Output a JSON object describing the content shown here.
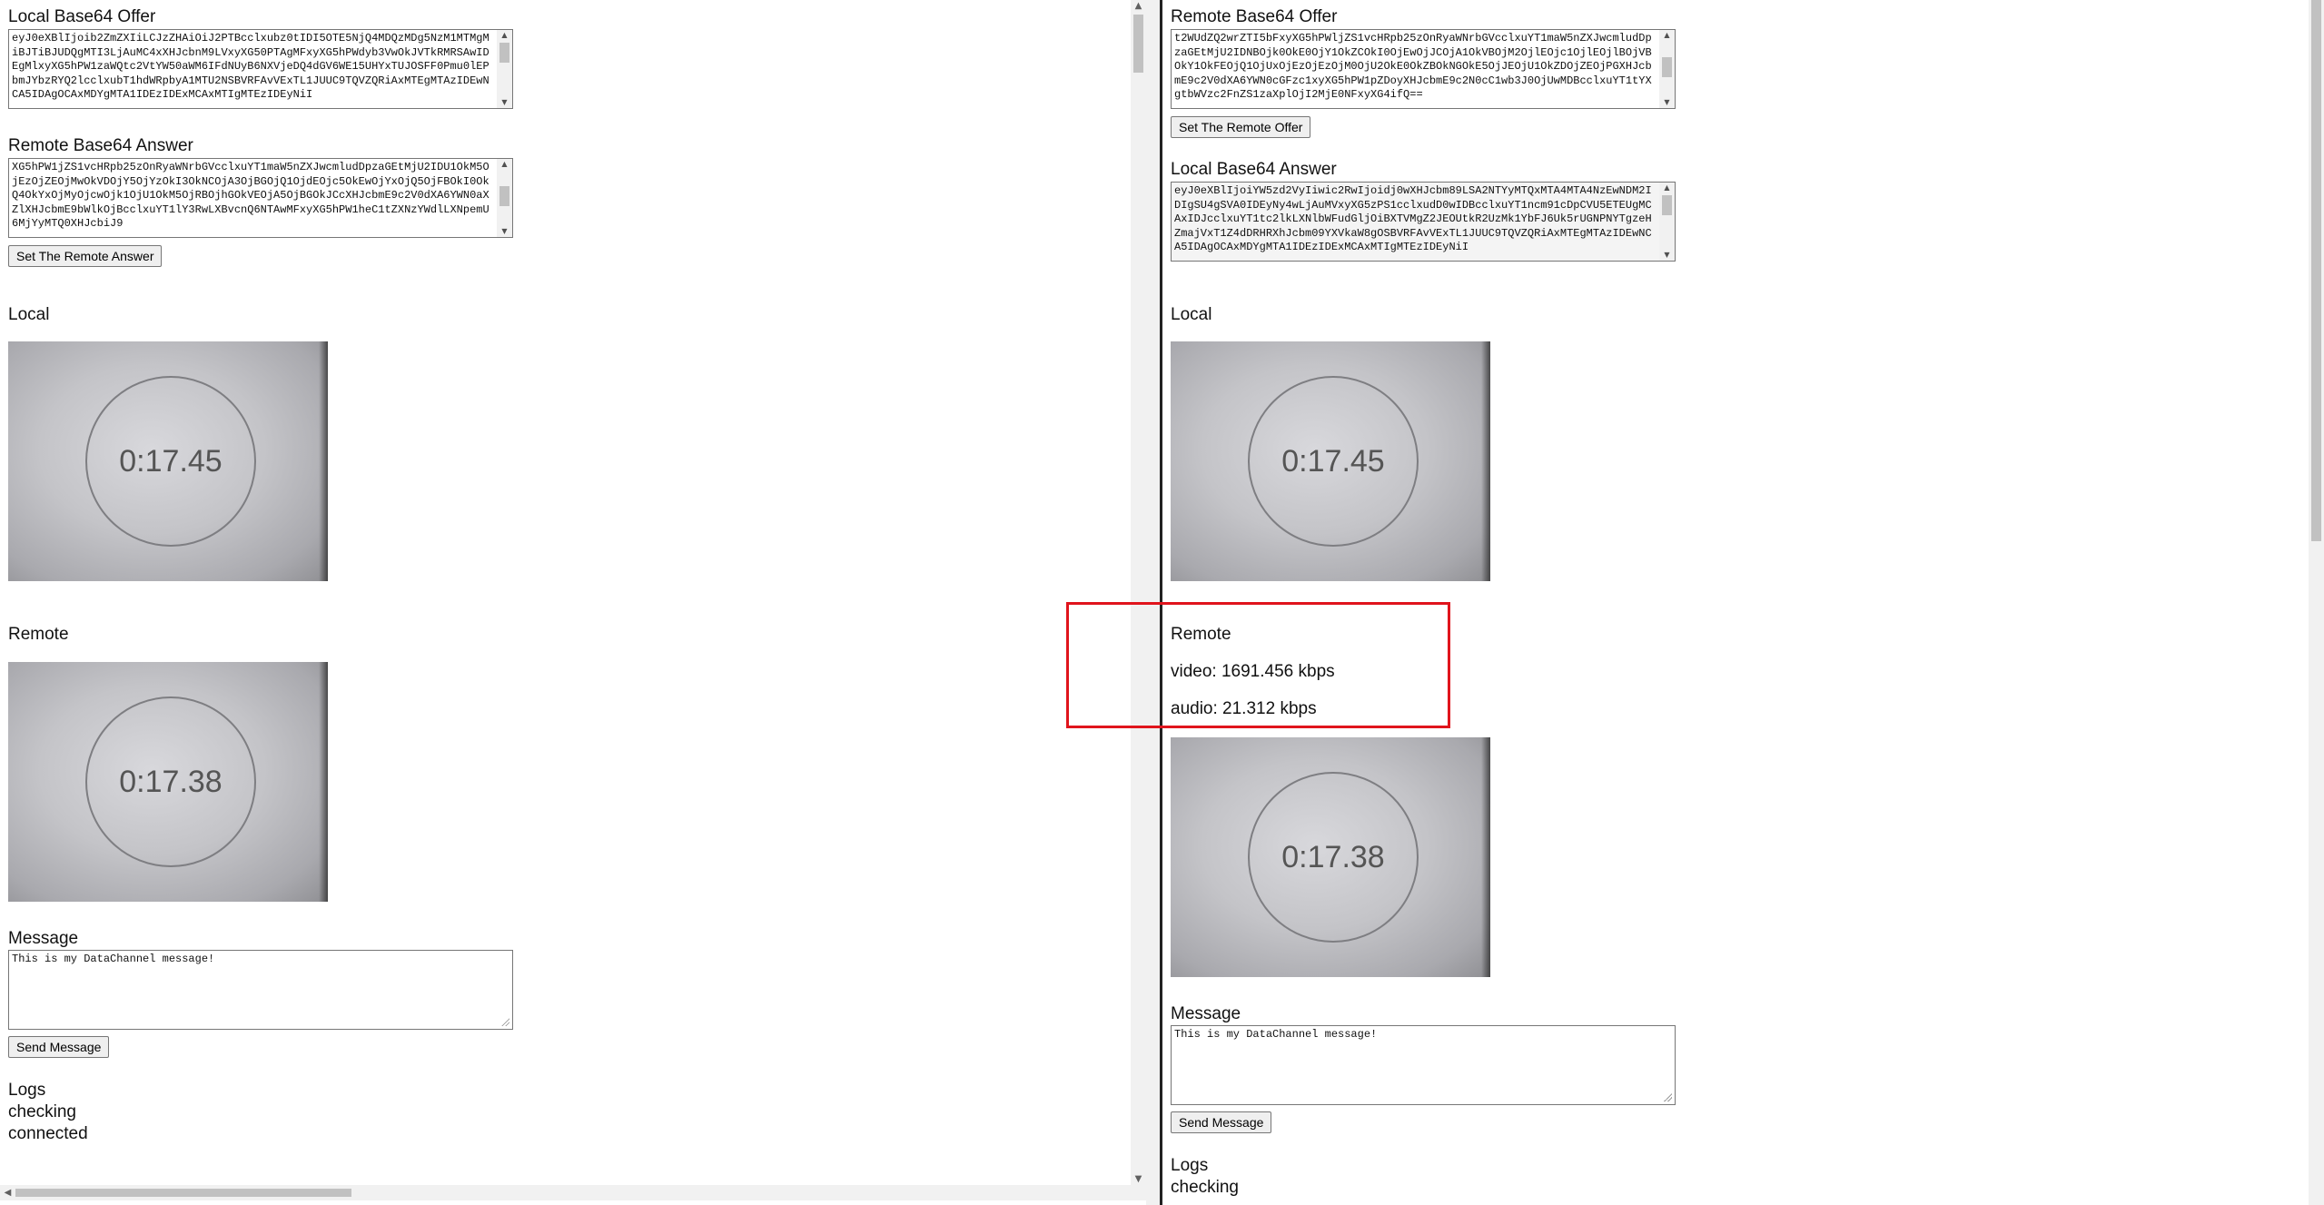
{
  "left": {
    "offer_label": "Local Base64 Offer",
    "offer_value": "eyJ0eXBlIjoib2ZmZXIiLCJzZHAiOiJ2PTBcclxubz0tIDI5OTE5NjQ4MDQzMDg5NzM1MTMgMiBJTiBJUDQgMTI3LjAuMC4xXHJcbnM9LVxyXG50PTAgMFxyXG5hPWdyb3VwOkJVTkRMRSAwIDEgMlxyXG5hPW1zaWQtc2VtYW50aWM6IFdNUyB6NXVjeDQ4dGV6WE15UHYxTUJOSFF0Pmu0lEPbmJYbzRYQ2lcclxubT1hdWRpbyA1MTU2NSBVRFAvVExTL1JUUC9TQVZQRiAxMTEgMTAzIDEwNCA5IDAgOCAxMDYgMTA1IDEzIDExMCAxMTIgMTEzIDEyNiI",
    "answer_label": "Remote Base64 Answer",
    "answer_value": "XG5hPW1jZS1vcHRpb25zOnRyaWNrbGVcclxuYT1maW5nZXJwcmludDpzaGEtMjU2IDU1OkM5OjEzOjZEOjMwOkVDOjY5OjYzOkI3OkNCOjA3OjBGOjQ1OjdEOjc5OkEwOjYxOjQ5OjFBOkI0OkQ4OkYxOjMyOjcwOjk1OjU1OkM5OjRBOjhGOkVEOjA5OjBGOkJCcXHJcbmE9c2V0dXA6YWN0aXZlXHJcbmE9bWlkOjBcclxuYT1lY3RwLXBvcnQ6NTAwMFxyXG5hPW1heC1tZXNzYWdlLXNpemU6MjYyMTQ0XHJcbiJ9",
    "set_answer_button": "Set The Remote Answer",
    "local_label": "Local",
    "local_timer": "0:17.45",
    "remote_label": "Remote",
    "remote_timer": "0:17.38",
    "message_label": "Message",
    "message_value": "This is my DataChannel message!",
    "send_button": "Send Message",
    "logs_label": "Logs",
    "logs": [
      "checking",
      "connected"
    ]
  },
  "right": {
    "offer_label": "Remote Base64 Offer",
    "offer_value": "t2WUdZQ2wrZTI5bFxyXG5hPWljZS1vcHRpb25zOnRyaWNrbGVcclxuYT1maW5nZXJwcmludDpzaGEtMjU2IDNBOjk0OkE0OjY1OkZCOkI0OjEwOjJCOjA1OkVBOjM2OjlEOjc1OjlEOjlBOjVBOkY1OkFEOjQ1OjUxOjEzOjEzOjM0OjU2OkE0OkZBOkNGOkE5OjJEOjU1OkZDOjZEOjPGXHJcbmE9c2V0dXA6YWN0cGFzc1xyXG5hPW1pZDoyXHJcbmE9c2N0cC1wb3J0OjUwMDBcclxuYT1tYXgtbWVzc2FnZS1zaXplOjI2MjE0NFxyXG4ifQ==",
    "set_offer_button": "Set The Remote Offer",
    "answer_label": "Local Base64 Answer",
    "answer_value": "eyJ0eXBlIjoiYW5zd2VyIiwic2RwIjoidj0wXHJcbm89LSA2NTYyMTQxMTA4MTA4NzEwNDM2IDIgSU4gSVA0IDEyNy4wLjAuMVxyXG5zPS1cclxudD0wIDBcclxuYT1ncm91cDpCVU5ETEUgMCAxIDJcclxuYT1tc2lkLXNlbWFudGljOiBXTVMgZ2JEOUtkR2UzMk1YbFJ6Uk5rUGNPNYTgzeHZmajVxT1Z4dDRHRXhJcbm09YXVkaW8gOSBVRFAvVExTL1JUUC9TQVZQRiAxMTEgMTAzIDEwNCA5IDAgOCAxMDYgMTA1IDEzIDExMCAxMTIgMTEzIDEyNiI",
    "local_label": "Local",
    "local_timer": "0:17.45",
    "remote_label": "Remote",
    "video_stat": "video: 1691.456 kbps",
    "audio_stat": "audio: 21.312 kbps",
    "remote_timer": "0:17.38",
    "message_label": "Message",
    "message_value": "This is my DataChannel message!",
    "send_button": "Send Message",
    "logs_label": "Logs",
    "logs": [
      "checking"
    ]
  },
  "colors": {
    "highlight": "#e0141c",
    "divider": "#222222"
  }
}
